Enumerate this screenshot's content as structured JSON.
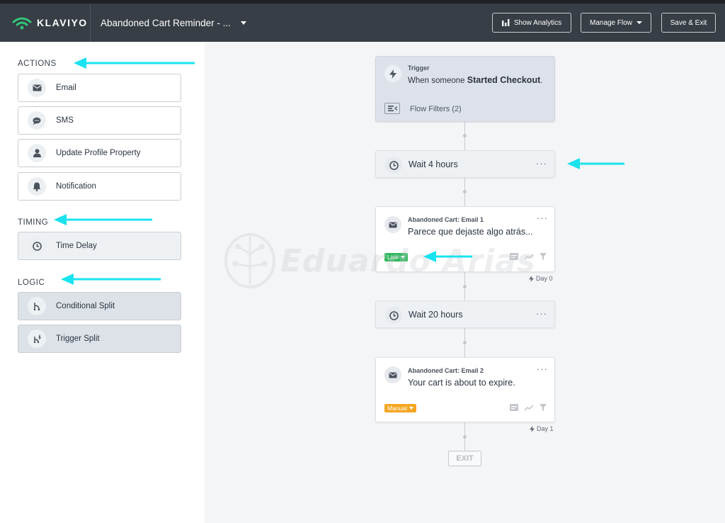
{
  "app": {
    "brand": "KLAVIYO",
    "accent": "#34c77b"
  },
  "header": {
    "flow_title": "Abandoned Cart Reminder - ...",
    "show_analytics": "Show Analytics",
    "manage_flow": "Manage Flow",
    "save_exit": "Save & Exit"
  },
  "sidebar": {
    "actions_title": "ACTIONS",
    "actions": [
      {
        "label": "Email",
        "icon": "envelope-icon"
      },
      {
        "label": "SMS",
        "icon": "chat-bubble-icon"
      },
      {
        "label": "Update Profile Property",
        "icon": "person-icon"
      },
      {
        "label": "Notification",
        "icon": "bell-icon"
      }
    ],
    "timing_title": "TIMING",
    "timing": [
      {
        "label": "Time Delay",
        "icon": "clock-icon"
      }
    ],
    "logic_title": "LOGIC",
    "logic": [
      {
        "label": "Conditional Split",
        "icon": "split-icon"
      },
      {
        "label": "Trigger Split",
        "icon": "trigger-split-icon"
      }
    ]
  },
  "flow": {
    "trigger": {
      "label": "Trigger",
      "prefix": "When someone",
      "event": "Started Checkout",
      "suffix": ".",
      "filters": "Flow Filters (2)"
    },
    "wait1": {
      "label": "Wait 4 hours",
      "menu": "···"
    },
    "email1": {
      "label": "Abandoned Cart: Email 1",
      "subject": "Parece que dejaste algo atrás...",
      "status": "Live",
      "status_color": "#2eb85c",
      "day": "Day 0",
      "menu": "···"
    },
    "wait2": {
      "label": "Wait 20 hours",
      "menu": "···"
    },
    "email2": {
      "label": "Abandoned Cart: Email 2",
      "subject": "Your cart is about to expire.",
      "status": "Manual",
      "status_color": "#f5a623",
      "day": "Day 1",
      "menu": "···"
    },
    "exit": "EXIT"
  },
  "annotations": {
    "arrow_color": "#19e3ee"
  },
  "watermark": {
    "text": "Eduardo Arias"
  }
}
